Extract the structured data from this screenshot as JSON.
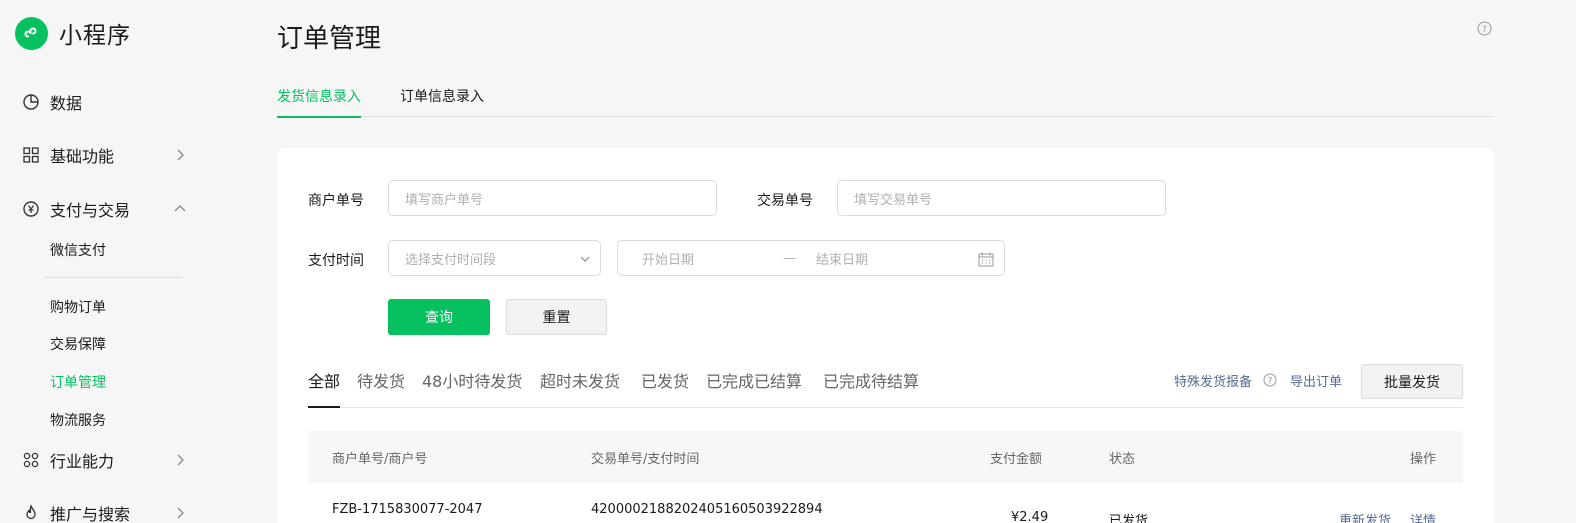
{
  "app": {
    "name": "小程序"
  },
  "sidebar": {
    "items": [
      {
        "label": "数据"
      },
      {
        "label": "基础功能"
      },
      {
        "label": "支付与交易"
      },
      {
        "label": "行业能力"
      },
      {
        "label": "推广与搜索"
      }
    ],
    "sub_items": [
      {
        "label": "微信支付"
      },
      {
        "label": "购物订单"
      },
      {
        "label": "交易保障"
      },
      {
        "label": "订单管理"
      },
      {
        "label": "物流服务"
      }
    ]
  },
  "page": {
    "title": "订单管理",
    "tabs": [
      {
        "label": "发货信息录入"
      },
      {
        "label": "订单信息录入"
      }
    ]
  },
  "filters": {
    "merchant_no": {
      "label": "商户单号",
      "placeholder": "填写商户单号"
    },
    "trade_no": {
      "label": "交易单号",
      "placeholder": "填写交易单号"
    },
    "pay_time": {
      "label": "支付时间",
      "select_placeholder": "选择支付时间段",
      "start_placeholder": "开始日期",
      "separator": "—",
      "end_placeholder": "结束日期"
    },
    "query_label": "查询",
    "reset_label": "重置"
  },
  "status_tabs": [
    {
      "label": "全部"
    },
    {
      "label": "待发货"
    },
    {
      "label": "48小时待发货"
    },
    {
      "label": "超时未发货"
    },
    {
      "label": "已发货"
    },
    {
      "label": "已完成已结算"
    },
    {
      "label": "已完成待结算"
    }
  ],
  "actions": {
    "special_report": "特殊发货报备",
    "export": "导出订单",
    "batch_ship": "批量发货"
  },
  "table": {
    "columns": [
      "商户单号/商户号",
      "交易单号/支付时间",
      "支付金额",
      "状态",
      "操作"
    ],
    "rows": [
      {
        "merchant_no": "FZB-1715830077-2047",
        "trade_no": "4200002188202405160503922894",
        "amount": "¥2.49",
        "status": "已发货",
        "action_reship": "重新发货",
        "action_detail": "详情"
      }
    ]
  },
  "colors": {
    "accent": "#07c160",
    "link": "#576b95"
  }
}
